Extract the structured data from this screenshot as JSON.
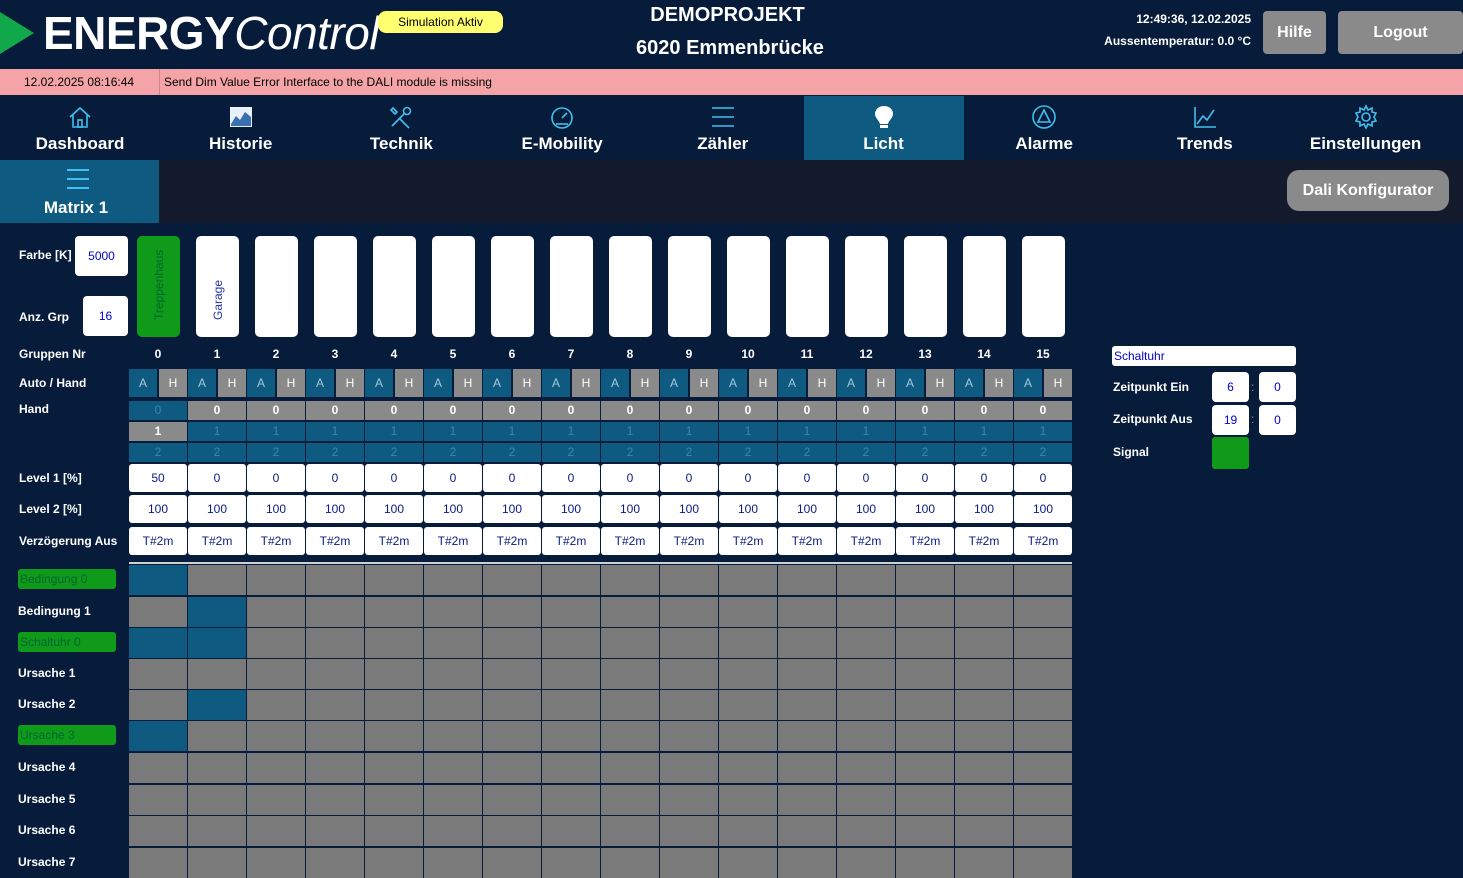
{
  "header": {
    "logo_bold": "ENERGY",
    "logo_italic": "Control",
    "simulation_badge": "Simulation Aktiv",
    "project_name": "DEMOPROJEKT",
    "project_city": "6020 Emmenbrücke",
    "clock": "12:49:36, 12.02.2025",
    "outdoor_temp": "Aussentemperatur: 0.0 °C",
    "help_label": "Hilfe",
    "logout_label": "Logout"
  },
  "alarm": {
    "time": "12.02.2025 08:16:44",
    "message": "Send Dim Value Error  Interface to the DALI module is missing"
  },
  "nav": {
    "items": [
      {
        "label": "Dashboard",
        "icon": "home-icon"
      },
      {
        "label": "Historie",
        "icon": "history-chart-icon"
      },
      {
        "label": "Technik",
        "icon": "tools-icon"
      },
      {
        "label": "E-Mobility",
        "icon": "gauge-icon"
      },
      {
        "label": "Zähler",
        "icon": "menu-icon"
      },
      {
        "label": "Licht",
        "icon": "lightbulb-icon",
        "active": true
      },
      {
        "label": "Alarme",
        "icon": "alarm-icon"
      },
      {
        "label": "Trends",
        "icon": "trend-chart-icon"
      },
      {
        "label": "Einstellungen",
        "icon": "gear-icon"
      }
    ]
  },
  "subnav": {
    "matrix_label": "Matrix 1",
    "dali_label": "Dali Konfigurator"
  },
  "left": {
    "farbe_label": "Farbe [K]",
    "farbe_value": "5000",
    "anzgrp_label": "Anz. Grp",
    "anzgrp_value": "16",
    "gruppen_label": "Gruppen Nr",
    "autohand_label": "Auto / Hand",
    "hand_label": "Hand",
    "level1_label": "Level 1 [%]",
    "level2_label": "Level 2 [%]",
    "delay_label": "Verzögerung Aus"
  },
  "groups": [
    {
      "nr": "0",
      "name": "Treppenhaus",
      "on": true,
      "hand_sel": 1,
      "level1": "50",
      "level2": "100",
      "delay": "T#2m"
    },
    {
      "nr": "1",
      "name": "Garage",
      "on": false,
      "hand_sel": 0,
      "level1": "0",
      "level2": "100",
      "delay": "T#2m"
    },
    {
      "nr": "2",
      "name": "",
      "on": false,
      "hand_sel": 0,
      "level1": "0",
      "level2": "100",
      "delay": "T#2m"
    },
    {
      "nr": "3",
      "name": "",
      "on": false,
      "hand_sel": 0,
      "level1": "0",
      "level2": "100",
      "delay": "T#2m"
    },
    {
      "nr": "4",
      "name": "",
      "on": false,
      "hand_sel": 0,
      "level1": "0",
      "level2": "100",
      "delay": "T#2m"
    },
    {
      "nr": "5",
      "name": "",
      "on": false,
      "hand_sel": 0,
      "level1": "0",
      "level2": "100",
      "delay": "T#2m"
    },
    {
      "nr": "6",
      "name": "",
      "on": false,
      "hand_sel": 0,
      "level1": "0",
      "level2": "100",
      "delay": "T#2m"
    },
    {
      "nr": "7",
      "name": "",
      "on": false,
      "hand_sel": 0,
      "level1": "0",
      "level2": "100",
      "delay": "T#2m"
    },
    {
      "nr": "8",
      "name": "",
      "on": false,
      "hand_sel": 0,
      "level1": "0",
      "level2": "100",
      "delay": "T#2m"
    },
    {
      "nr": "9",
      "name": "",
      "on": false,
      "hand_sel": 0,
      "level1": "0",
      "level2": "100",
      "delay": "T#2m"
    },
    {
      "nr": "10",
      "name": "",
      "on": false,
      "hand_sel": 0,
      "level1": "0",
      "level2": "100",
      "delay": "T#2m"
    },
    {
      "nr": "11",
      "name": "",
      "on": false,
      "hand_sel": 0,
      "level1": "0",
      "level2": "100",
      "delay": "T#2m"
    },
    {
      "nr": "12",
      "name": "",
      "on": false,
      "hand_sel": 0,
      "level1": "0",
      "level2": "100",
      "delay": "T#2m"
    },
    {
      "nr": "13",
      "name": "",
      "on": false,
      "hand_sel": 0,
      "level1": "0",
      "level2": "100",
      "delay": "T#2m"
    },
    {
      "nr": "14",
      "name": "",
      "on": false,
      "hand_sel": 0,
      "level1": "0",
      "level2": "100",
      "delay": "T#2m"
    },
    {
      "nr": "15",
      "name": "",
      "on": false,
      "hand_sel": 0,
      "level1": "0",
      "level2": "100",
      "delay": "T#2m"
    }
  ],
  "autohand": {
    "auto": "A",
    "hand": "H"
  },
  "hand_options": [
    "0",
    "1",
    "2"
  ],
  "conditions": [
    {
      "label": "Bedingung 0",
      "active": true,
      "cells": [
        0
      ]
    },
    {
      "label": "Bedingung 1",
      "active": false,
      "cells": [
        1
      ]
    },
    {
      "label": "Schaltuhr 0",
      "active": true,
      "cells": [
        0,
        1
      ]
    },
    {
      "label": "Ursache 1",
      "active": false,
      "cells": []
    },
    {
      "label": "Ursache 2",
      "active": false,
      "cells": [
        1
      ]
    },
    {
      "label": "Ursache 3",
      "active": true,
      "cells": [
        0
      ]
    },
    {
      "label": "Ursache 4",
      "active": false,
      "cells": []
    },
    {
      "label": "Ursache 5",
      "active": false,
      "cells": []
    },
    {
      "label": "Ursache 6",
      "active": false,
      "cells": []
    },
    {
      "label": "Ursache 7",
      "active": false,
      "cells": []
    }
  ],
  "schedule": {
    "name": "Schaltuhr",
    "on_label": "Zeitpunkt Ein",
    "on_hour": "6",
    "on_min": "0",
    "off_label": "Zeitpunkt Aus",
    "off_hour": "19",
    "off_min": "0",
    "sep": ":",
    "signal_label": "Signal",
    "signal_color": "#0f9a1a"
  },
  "colors": {
    "bg": "#071b3a",
    "accent": "#0e5a80",
    "alarm": "#f4a3a6",
    "green": "#0f9a1a"
  }
}
